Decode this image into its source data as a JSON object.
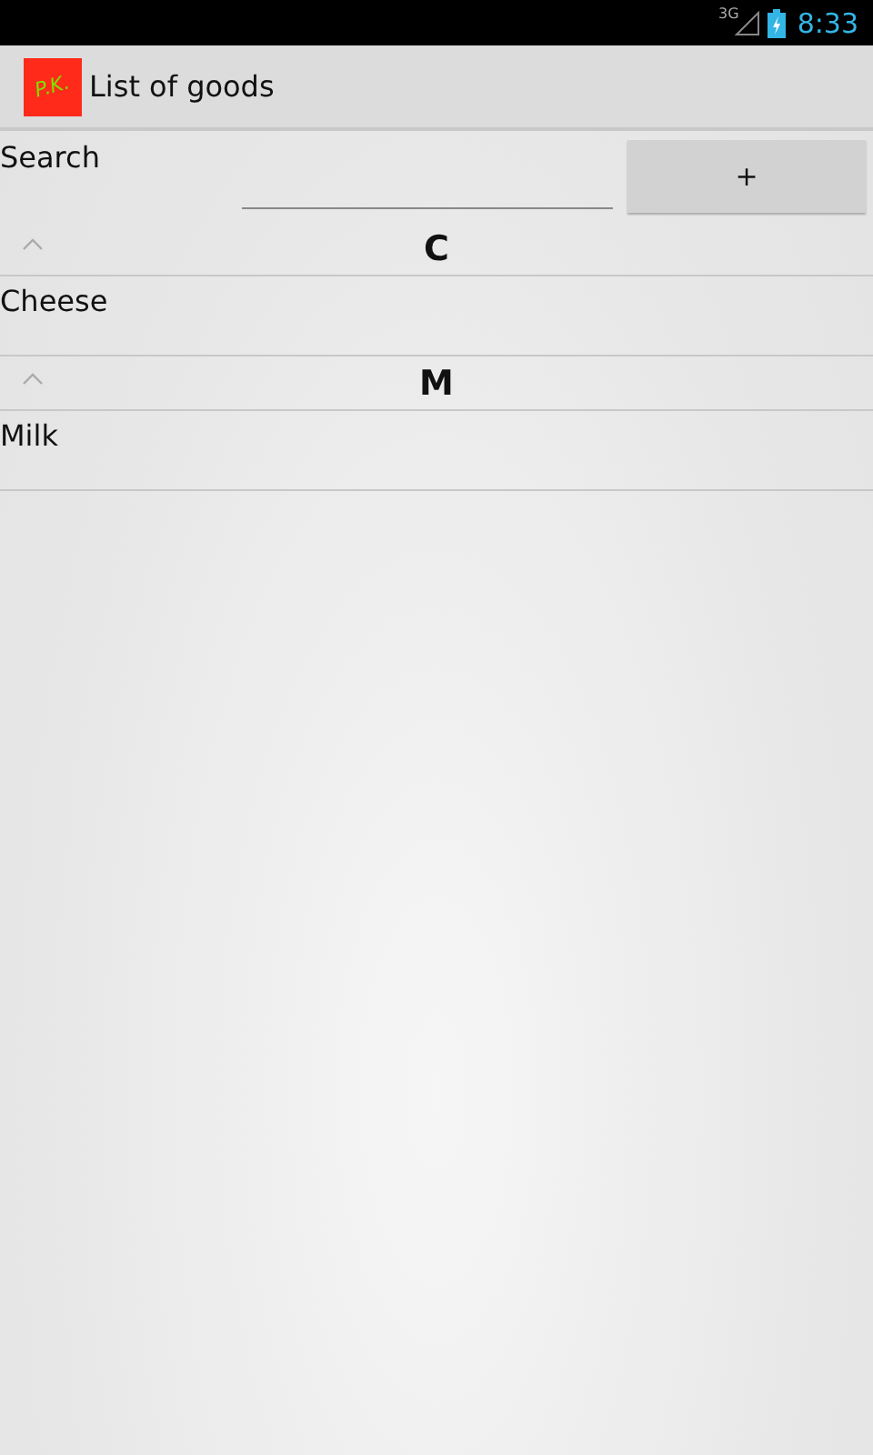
{
  "status_bar": {
    "network": "3G",
    "time": "8:33"
  },
  "action_bar": {
    "logo_text": "P.K.",
    "title": "List of goods"
  },
  "search": {
    "label": "Search",
    "button": "+"
  },
  "groups": [
    {
      "letter": "C",
      "expanded": true,
      "items": [
        "Cheese"
      ]
    },
    {
      "letter": "M",
      "expanded": true,
      "items": [
        "Milk"
      ]
    }
  ]
}
